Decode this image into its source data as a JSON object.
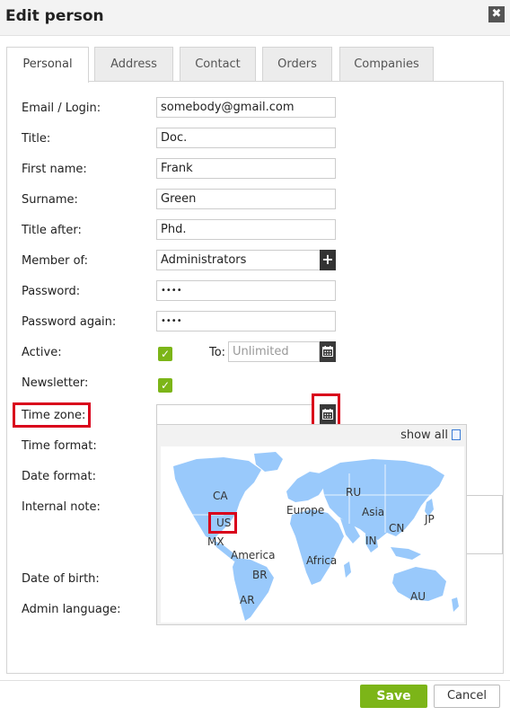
{
  "dialog": {
    "title": "Edit person",
    "close_label": "✖"
  },
  "tabs": [
    {
      "label": "Personal",
      "active": true
    },
    {
      "label": "Address"
    },
    {
      "label": "Contact"
    },
    {
      "label": "Orders"
    },
    {
      "label": "Companies"
    }
  ],
  "form": {
    "email": {
      "label": "Email / Login:",
      "value": "somebody@gmail.com"
    },
    "title": {
      "label": "Title:",
      "value": "Doc."
    },
    "first_name": {
      "label": "First name:",
      "value": "Frank"
    },
    "surname": {
      "label": "Surname:",
      "value": "Green"
    },
    "title_after": {
      "label": "Title after:",
      "value": "Phd."
    },
    "member_of": {
      "label": "Member of:",
      "value": "Administrators",
      "add_label": "+"
    },
    "password": {
      "label": "Password:",
      "value": "••••"
    },
    "password_again": {
      "label": "Password again:",
      "value": "••••"
    },
    "active": {
      "label": "Active:",
      "checked": true,
      "to_label": "To:",
      "to_placeholder": "Unlimited"
    },
    "newsletter": {
      "label": "Newsletter:",
      "checked": true
    },
    "time_zone": {
      "label": "Time zone:",
      "value": ""
    },
    "time_format": {
      "label": "Time format:"
    },
    "date_format": {
      "label": "Date format:"
    },
    "internal_note": {
      "label": "Internal note:"
    },
    "date_of_birth": {
      "label": "Date of birth:"
    },
    "admin_language": {
      "label": "Admin language:"
    }
  },
  "timezone_popup": {
    "show_all_label": "show all",
    "map_color": "#99c9fb",
    "regions": [
      "CA",
      "US",
      "MX",
      "America",
      "BR",
      "AR",
      "Europe",
      "Africa",
      "RU",
      "Asia",
      "CN",
      "IN",
      "JP",
      "AU"
    ]
  },
  "footer": {
    "save_label": "Save",
    "cancel_label": "Cancel"
  },
  "colors": {
    "accent_green": "#7cb518",
    "highlight_red": "#d9001b"
  }
}
